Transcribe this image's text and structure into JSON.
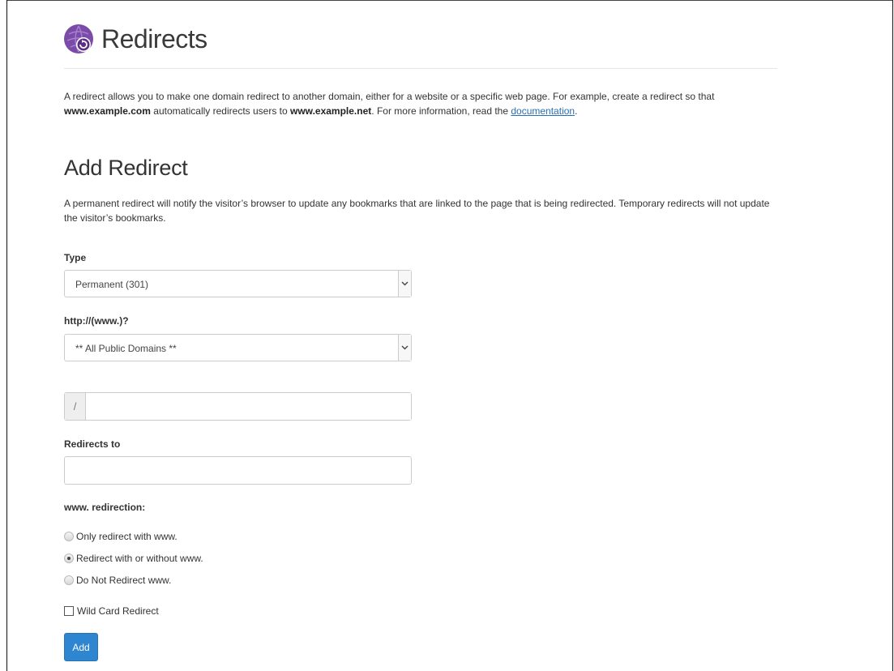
{
  "header": {
    "title": "Redirects",
    "logo_icon": "redirect-globe-icon",
    "brand_color": "#7b4ba8"
  },
  "intro": {
    "text_1": "A redirect allows you to make one domain redirect to another domain, either for a website or a specific web page. For example, create a redirect so that ",
    "bold_1": "www.example.com",
    "text_2": " automatically redirects users to ",
    "bold_2": "www.example.net",
    "text_3": ". For more information, read the ",
    "link": "documentation",
    "text_4": "."
  },
  "add_redirect": {
    "title": "Add Redirect",
    "description": "A permanent redirect will notify the visitor’s browser to update any bookmarks that are linked to the page that is being redirected. Temporary redirects will not update the visitor’s bookmarks.",
    "type_label": "Type",
    "type_value": "Permanent (301)",
    "domain_label": "http://(www.)?",
    "domain_value": "** All Public Domains **",
    "path_prefix": "/",
    "path_value": "",
    "redirects_to_label": "Redirects to",
    "redirects_to_value": "",
    "www_label": "www. redirection:",
    "www_options": [
      {
        "label": "Only redirect with www.",
        "checked": false
      },
      {
        "label": "Redirect with or without www.",
        "checked": true
      },
      {
        "label": "Do Not Redirect www.",
        "checked": false
      }
    ],
    "wildcard_label": "Wild Card Redirect",
    "wildcard_checked": false,
    "add_button": "Add",
    "button_color": "#2f86d0"
  }
}
